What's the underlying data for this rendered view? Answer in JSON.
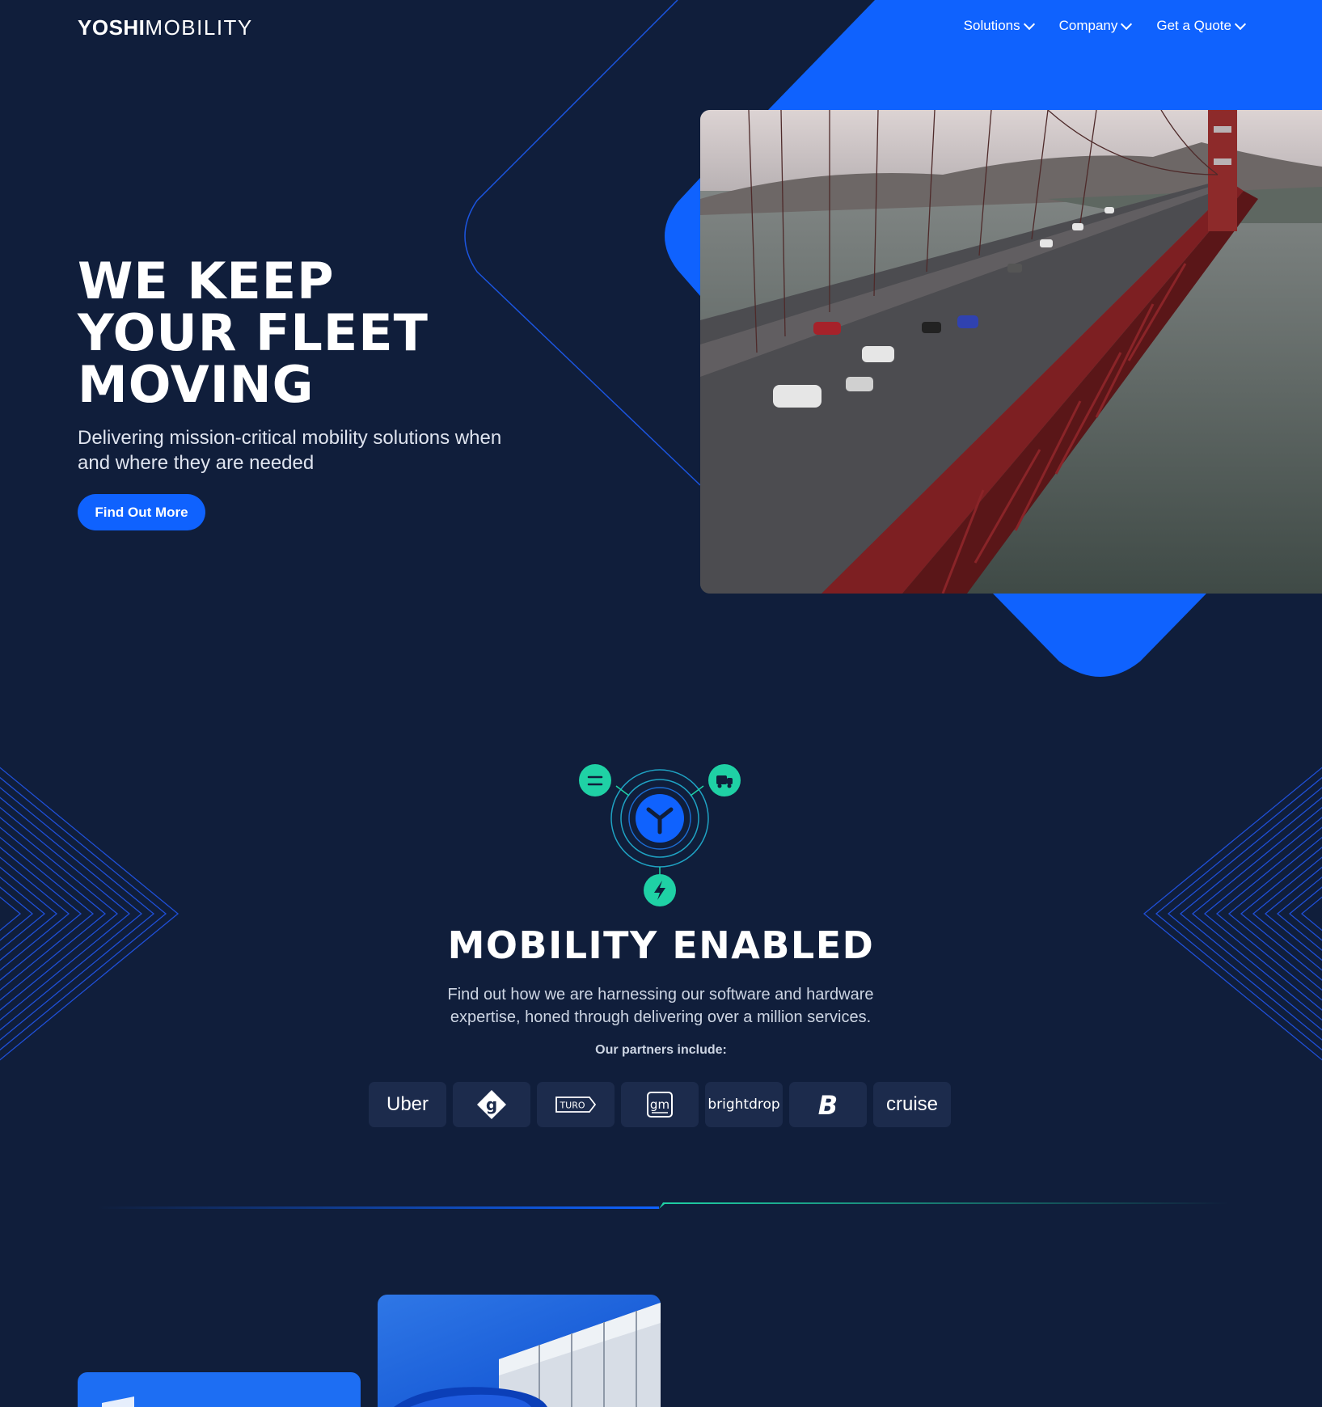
{
  "header": {
    "logo_bold": "YOSHI",
    "logo_thin": "MOBILITY",
    "nav": [
      {
        "label": "Solutions"
      },
      {
        "label": "Company"
      },
      {
        "label": "Get a Quote"
      }
    ]
  },
  "hero": {
    "title_lines": [
      "WE KEEP",
      "YOUR FLEET",
      "MOVING"
    ],
    "subtitle": "Delivering mission-critical mobility solutions when and where they are needed",
    "cta": "Find Out More"
  },
  "mobility": {
    "title": "MOBILITY ENABLED",
    "description": "Find out how we are harnessing our software and hardware expertise, honed through delivering over a million services.",
    "partners_label": "Our partners include:",
    "partners": [
      "Uber",
      "g",
      "TURO",
      "gm",
      "brightdrop",
      "B",
      "cruise"
    ]
  },
  "colors": {
    "background": "#101e3b",
    "accent": "#0f62fe",
    "teal": "#1fd1a5",
    "tile": "#1c2b4c"
  }
}
